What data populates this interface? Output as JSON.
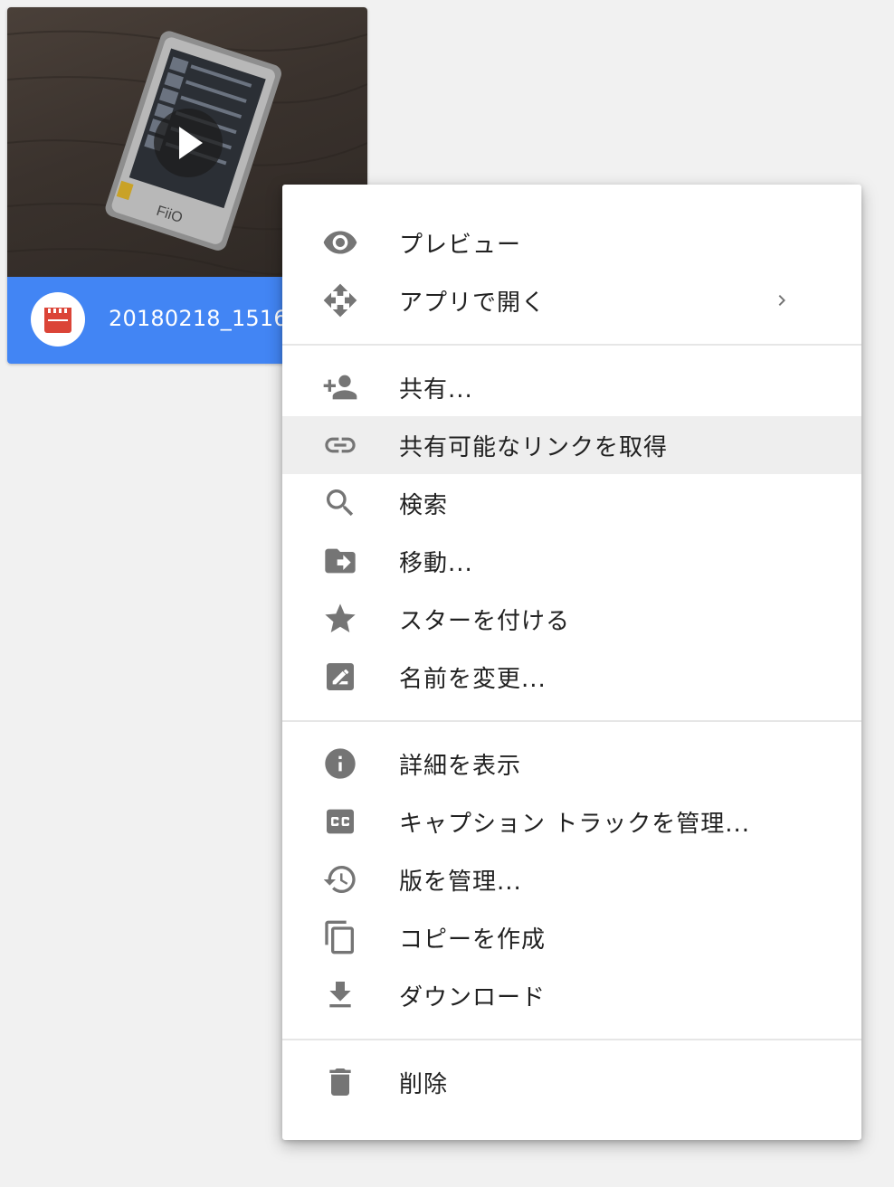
{
  "file": {
    "name": "20180218_15161",
    "icon": "video-file-icon",
    "badge_color": "#db4437",
    "footer_color": "#4285f4",
    "thumbnail_icon": "play-icon"
  },
  "menu": {
    "groups": [
      {
        "items": [
          {
            "label": "プレビュー",
            "icon": "eye-icon"
          },
          {
            "label": "アプリで開く",
            "icon": "open-with-icon",
            "submenu": true
          }
        ]
      },
      {
        "items": [
          {
            "label": "共有...",
            "icon": "person-add-icon"
          },
          {
            "label": "共有可能なリンクを取得",
            "icon": "link-icon",
            "highlighted": true
          },
          {
            "label": "検索",
            "icon": "search-icon"
          },
          {
            "label": "移動...",
            "icon": "move-to-folder-icon"
          },
          {
            "label": "スターを付ける",
            "icon": "star-icon"
          },
          {
            "label": "名前を変更...",
            "icon": "rename-icon"
          }
        ]
      },
      {
        "items": [
          {
            "label": "詳細を表示",
            "icon": "info-icon"
          },
          {
            "label": "キャプション トラックを管理...",
            "icon": "closed-caption-icon"
          },
          {
            "label": "版を管理...",
            "icon": "history-icon"
          },
          {
            "label": "コピーを作成",
            "icon": "copy-icon"
          },
          {
            "label": "ダウンロード",
            "icon": "download-icon"
          }
        ]
      },
      {
        "items": [
          {
            "label": "削除",
            "icon": "trash-icon"
          }
        ]
      }
    ],
    "icon_color": "#757575",
    "highlight_color": "#eeeeee"
  }
}
